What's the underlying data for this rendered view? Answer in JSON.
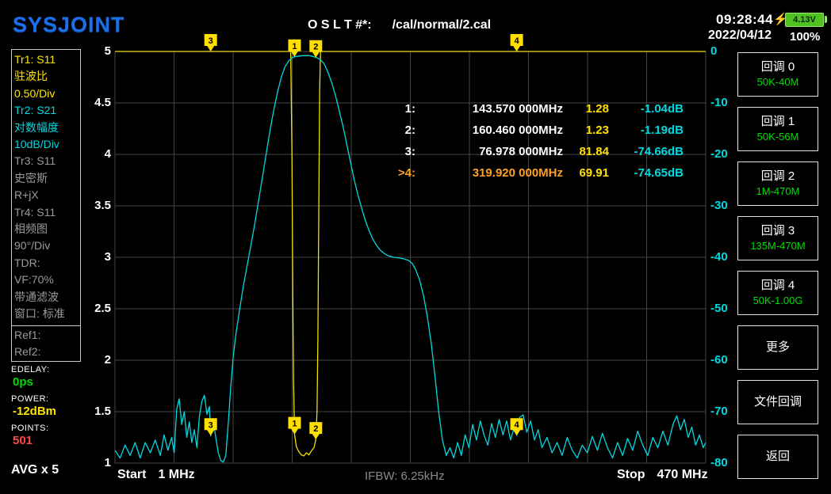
{
  "header": {
    "logo": "SYSJOINT",
    "cal_label": "O S L T #*:",
    "cal_path": "/cal/normal/2.cal",
    "time": "09:28:44",
    "date": "2022/04/12",
    "bolt_icon": "⚡",
    "battery_voltage": "4.13V",
    "battery_percent": "100%"
  },
  "sidebar_left": {
    "trace_lines": [
      {
        "text": "Tr1:  S11",
        "color": "yellow"
      },
      {
        "text": "驻波比",
        "color": "yellow"
      },
      {
        "text": "0.50/Div",
        "color": "yellow"
      },
      {
        "text": "Tr2:  S21",
        "color": "cyan"
      },
      {
        "text": "对数幅度",
        "color": "cyan"
      },
      {
        "text": "10dB/Div",
        "color": "cyan"
      },
      {
        "text": "Tr3:  S11",
        "color": "gray"
      },
      {
        "text": "史密斯",
        "color": "gray"
      },
      {
        "text": "R+jX",
        "color": "gray"
      },
      {
        "text": "Tr4:  S11",
        "color": "gray"
      },
      {
        "text": "相频图",
        "color": "gray"
      },
      {
        "text": "90°/Div",
        "color": "gray"
      },
      {
        "text": "TDR:",
        "color": "gray"
      },
      {
        "text": "VF:70%",
        "color": "gray"
      },
      {
        "text": "带通滤波",
        "color": "gray"
      },
      {
        "text": "窗口: 标准",
        "color": "gray"
      }
    ],
    "ref_lines": [
      {
        "text": "Ref1:",
        "color": "gray"
      },
      {
        "text": "Ref2:",
        "color": "gray"
      }
    ],
    "status": [
      {
        "label": "EDELAY:",
        "value": "0ps",
        "color": "green"
      },
      {
        "label": "POWER:",
        "value": "-12dBm",
        "color": "yellow"
      },
      {
        "label": "POINTS:",
        "value": "501",
        "color": "red"
      }
    ],
    "avg": "AVG x 5"
  },
  "chart_data": {
    "type": "line",
    "x_range_mhz": [
      1,
      470
    ],
    "swr_range": [
      1,
      5
    ],
    "db_range": [
      -80,
      0
    ],
    "left_ticks": [
      "5",
      "4.5",
      "4",
      "3.5",
      "3",
      "2.5",
      "2",
      "1.5",
      "1"
    ],
    "right_ticks": [
      "0",
      "-10",
      "-20",
      "-30",
      "-40",
      "-50",
      "-60",
      "-70",
      "-80"
    ],
    "grid_divisions_x": 10,
    "grid_divisions_y": 8,
    "series": [
      {
        "name": "Tr1 S11 SWR 0.50/Div",
        "unit": "SWR",
        "color": "#f0e000",
        "points": [
          [
            1,
            5
          ],
          [
            140.5,
            5
          ],
          [
            141.5,
            4.0
          ],
          [
            142.2,
            2.6
          ],
          [
            142.8,
            1.8
          ],
          [
            143.57,
            1.28
          ],
          [
            145,
            1.16
          ],
          [
            147,
            1.11
          ],
          [
            149,
            1.08
          ],
          [
            151,
            1.07
          ],
          [
            153,
            1.1
          ],
          [
            155,
            1.08
          ],
          [
            157,
            1.12
          ],
          [
            159,
            1.15
          ],
          [
            160.46,
            1.23
          ],
          [
            161.4,
            1.5
          ],
          [
            162.1,
            2.2
          ],
          [
            162.8,
            3.4
          ],
          [
            163.5,
            4.6
          ],
          [
            164.2,
            5
          ],
          [
            470,
            5
          ]
        ]
      },
      {
        "name": "Tr2 S21 LogMag 10dB/Div",
        "unit": "dB",
        "color": "#00d9e0",
        "points": [
          [
            1,
            -77.5
          ],
          [
            5,
            -79
          ],
          [
            9,
            -76.5
          ],
          [
            13,
            -78.5
          ],
          [
            17,
            -76
          ],
          [
            21,
            -79
          ],
          [
            25,
            -76
          ],
          [
            29,
            -78
          ],
          [
            33,
            -75.5
          ],
          [
            37,
            -78.5
          ],
          [
            40,
            -74.5
          ],
          [
            43,
            -77.5
          ],
          [
            46,
            -75
          ],
          [
            48,
            -78
          ],
          [
            50,
            -69.5
          ],
          [
            52,
            -67.5
          ],
          [
            54,
            -72.5
          ],
          [
            56,
            -70
          ],
          [
            58,
            -75
          ],
          [
            60,
            -72
          ],
          [
            62,
            -76
          ],
          [
            64,
            -73.5
          ],
          [
            66,
            -77
          ],
          [
            68,
            -71
          ],
          [
            70,
            -68
          ],
          [
            72,
            -66.8
          ],
          [
            74,
            -70.5
          ],
          [
            76,
            -69
          ],
          [
            77,
            -74.7
          ],
          [
            79,
            -71.5
          ],
          [
            81,
            -75
          ],
          [
            83,
            -78
          ],
          [
            85,
            -79.5
          ],
          [
            87,
            -79.8
          ],
          [
            89,
            -78.5
          ],
          [
            91,
            -72
          ],
          [
            93,
            -65
          ],
          [
            95,
            -59
          ],
          [
            97,
            -55
          ],
          [
            100,
            -50
          ],
          [
            103,
            -45.5
          ],
          [
            106,
            -41.5
          ],
          [
            109,
            -37.5
          ],
          [
            112,
            -33.5
          ],
          [
            115,
            -29
          ],
          [
            118,
            -24.5
          ],
          [
            121,
            -20
          ],
          [
            124,
            -15.5
          ],
          [
            127,
            -11.5
          ],
          [
            130,
            -8
          ],
          [
            133,
            -5
          ],
          [
            136,
            -3
          ],
          [
            139,
            -1.8
          ],
          [
            142,
            -1.15
          ],
          [
            145,
            -0.95
          ],
          [
            150,
            -0.82
          ],
          [
            155,
            -0.8
          ],
          [
            158,
            -0.95
          ],
          [
            161,
            -1.2
          ],
          [
            164,
            -1.55
          ],
          [
            167,
            -2.4
          ],
          [
            170,
            -4
          ],
          [
            173,
            -6
          ],
          [
            176,
            -8.5
          ],
          [
            179,
            -11.5
          ],
          [
            182,
            -14.5
          ],
          [
            185,
            -18
          ],
          [
            188,
            -21.5
          ],
          [
            191,
            -25
          ],
          [
            194,
            -28
          ],
          [
            197,
            -30.6
          ],
          [
            200,
            -33
          ],
          [
            203,
            -35
          ],
          [
            206,
            -36.6
          ],
          [
            209,
            -37.8
          ],
          [
            212,
            -38.7
          ],
          [
            215,
            -39.3
          ],
          [
            218,
            -39.7
          ],
          [
            222,
            -40
          ],
          [
            226,
            -40.1
          ],
          [
            230,
            -40.3
          ],
          [
            234,
            -40.6
          ],
          [
            237,
            -41.2
          ],
          [
            240,
            -42.5
          ],
          [
            243,
            -44.5
          ],
          [
            246,
            -47.5
          ],
          [
            249,
            -51.5
          ],
          [
            252,
            -56.5
          ],
          [
            255,
            -63
          ],
          [
            258,
            -70
          ],
          [
            261,
            -75.5
          ],
          [
            264,
            -78.5
          ],
          [
            267,
            -77
          ],
          [
            270,
            -79
          ],
          [
            273,
            -76
          ],
          [
            276,
            -78.5
          ],
          [
            279,
            -74.5
          ],
          [
            282,
            -77
          ],
          [
            285,
            -72.5
          ],
          [
            288,
            -75.5
          ],
          [
            291,
            -71.8
          ],
          [
            294,
            -74.5
          ],
          [
            297,
            -76.5
          ],
          [
            300,
            -72.3
          ],
          [
            303,
            -75
          ],
          [
            306,
            -71.5
          ],
          [
            309,
            -74.5
          ],
          [
            312,
            -71.8
          ],
          [
            315,
            -75.5
          ],
          [
            318,
            -73
          ],
          [
            320,
            -74.6
          ],
          [
            322,
            -71.2
          ],
          [
            325,
            -70.6
          ],
          [
            328,
            -74
          ],
          [
            331,
            -71.8
          ],
          [
            334,
            -75.5
          ],
          [
            337,
            -73.5
          ],
          [
            340,
            -77
          ],
          [
            344,
            -75
          ],
          [
            348,
            -78
          ],
          [
            352,
            -76
          ],
          [
            356,
            -78.5
          ],
          [
            360,
            -75
          ],
          [
            364,
            -77.5
          ],
          [
            368,
            -79
          ],
          [
            372,
            -76.5
          ],
          [
            376,
            -78
          ],
          [
            380,
            -74.8
          ],
          [
            384,
            -77.5
          ],
          [
            388,
            -74.2
          ],
          [
            392,
            -77
          ],
          [
            396,
            -79
          ],
          [
            400,
            -76
          ],
          [
            404,
            -78.5
          ],
          [
            408,
            -75.2
          ],
          [
            412,
            -77.5
          ],
          [
            416,
            -73.8
          ],
          [
            420,
            -76.5
          ],
          [
            424,
            -78.5
          ],
          [
            428,
            -75
          ],
          [
            432,
            -77
          ],
          [
            436,
            -73.8
          ],
          [
            440,
            -76.5
          ],
          [
            444,
            -72.5
          ],
          [
            447,
            -70.8
          ],
          [
            450,
            -73.5
          ],
          [
            453,
            -71.5
          ],
          [
            456,
            -75
          ],
          [
            459,
            -73
          ],
          [
            462,
            -76.5
          ],
          [
            465,
            -74.5
          ],
          [
            468,
            -77
          ],
          [
            470,
            -76
          ]
        ]
      }
    ],
    "markers": [
      {
        "id": "1",
        "row_label": "1:",
        "freq_mhz": 143.57,
        "freq_text": "143.570 000MHz",
        "swr": 1.28,
        "swr_text": "1.28",
        "db": -1.04,
        "db_text": "-1.04dB",
        "highlight": false
      },
      {
        "id": "2",
        "row_label": "2:",
        "freq_mhz": 160.46,
        "freq_text": "160.460 000MHz",
        "swr": 1.23,
        "swr_text": "1.23",
        "db": -1.19,
        "db_text": "-1.19dB",
        "highlight": false
      },
      {
        "id": "3",
        "row_label": "3:",
        "freq_mhz": 76.978,
        "freq_text": "76.978 000MHz",
        "swr": 81.84,
        "swr_text": "81.84",
        "db": -74.66,
        "db_text": "-74.66dB",
        "highlight": false
      },
      {
        "id": "4",
        "row_label": ">4:",
        "freq_mhz": 319.92,
        "freq_text": "319.920 000MHz",
        "swr": 69.91,
        "swr_text": "69.91",
        "db": -74.65,
        "db_text": "-74.65dB",
        "highlight": true
      }
    ],
    "marker_flag_color": "#ffdf00"
  },
  "footer": {
    "start_label": "Start",
    "start_value": "1 MHz",
    "ifbw": "IFBW: 6.25kHz",
    "stop_label": "Stop",
    "stop_value": "470 MHz"
  },
  "sidebar_right": {
    "buttons": [
      {
        "label": "回调 0",
        "sub": "50K-40M"
      },
      {
        "label": "回调 1",
        "sub": "50K-56M"
      },
      {
        "label": "回调 2",
        "sub": "1M-470M"
      },
      {
        "label": "回调 3",
        "sub": "135M-470M"
      },
      {
        "label": "回调 4",
        "sub": "50K-1.00G"
      },
      {
        "label": "更多",
        "sub": ""
      },
      {
        "label": "文件回调",
        "sub": ""
      },
      {
        "label": "返回",
        "sub": ""
      }
    ]
  },
  "colors": {
    "trace_swr": "#f0e000",
    "trace_s21": "#00d9e0",
    "marker_flag": "#ffdf00",
    "recall_green": "#00dd00",
    "highlight_orange": "#ffa020",
    "logo_blue": "#1d6fe8",
    "points_red": "#ff4545",
    "grid": "#464646"
  }
}
